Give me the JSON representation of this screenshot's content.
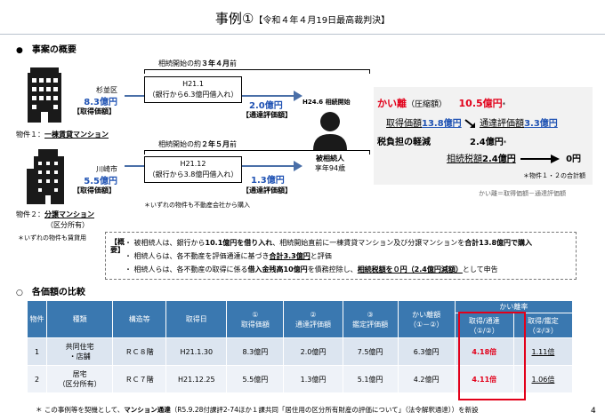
{
  "header": {
    "title": "事例①",
    "subtitle": "【令和４年４月19日最高裁判決】"
  },
  "section1": {
    "bullet": "●",
    "title": "事案の概要"
  },
  "prop1": {
    "location": "杉並区",
    "price": "8.3億円",
    "price_label": "【取得価額】",
    "caption_label": "物件１：",
    "caption_name": "一棟賃貸マンション",
    "period_prefix": "相続開始の約",
    "period_years": "３年４月",
    "period_suffix": "前",
    "box_line1": "H21.1",
    "box_line2": "（銀行から6.3億円借入れ）",
    "appraisal": "2.0億円",
    "appraisal_label": "【通達評価額】"
  },
  "prop2": {
    "location": "川崎市",
    "price": "5.5億円",
    "price_label": "【取得価額】",
    "caption_label": "物件２：",
    "caption_name": "分譲マンション",
    "caption_sub": "（区分所有）",
    "period_prefix": "相続開始の約",
    "period_years": "２年５月",
    "period_suffix": "前",
    "box_line1": "H21.12",
    "box_line2": "（銀行から3.8億円借入れ）",
    "appraisal": "1.3億円",
    "appraisal_label": "【通達評価額】"
  },
  "note_props": "＊いずれの物件も賃貸用",
  "note_nocompany": "＊いずれの物件も不動産会社から購入",
  "person": {
    "top_label": "H24.6 相続開始",
    "name": "被相続人",
    "age": "享年94歳"
  },
  "gap": {
    "label": "かい離",
    "label_paren": "（圧縮額）",
    "value": "10.5億円",
    "value_mark": "*",
    "acq_label": "取得価額",
    "acq_value": "13.8億円",
    "eval_label": "通達評価額",
    "eval_value": "3.3億円",
    "tax_label": "税負担の軽減",
    "tax_value": "2.4億円",
    "tax_mark": "*",
    "tax_row_label": "相続税額",
    "tax_row_value": "2.4億円",
    "tax_zero": "0円",
    "footnote": "＊物件１・２の合計額",
    "formula": "かい離＝取得価額－通達評価額"
  },
  "summary": {
    "side_label": "【概要】",
    "items": [
      {
        "pre": "被相続人は、銀行から",
        "bold1": "10.1億円を借り入れ",
        "mid": "、相続開始直前に一棟賃貸マンション及び分譲マンションを",
        "bold2": "合計13.8億円で購入",
        "post": ""
      },
      {
        "pre": "相続人らは、各不動産を評価通達に基づき",
        "bold1": "合計3.3億円",
        "mid": "と評価",
        "bold2": "",
        "post": ""
      },
      {
        "pre": "相続人らは、各不動産の取得に係る",
        "bold1": "借入金残高10億円",
        "mid": "を債務控除し、",
        "bold2": "相続税額を０円（2.4億円減額）",
        "post": "として申告"
      }
    ]
  },
  "section2": {
    "bullet": "○",
    "title": "各価額の比較"
  },
  "table": {
    "headers": {
      "no": "物件",
      "type": "種類",
      "structure": "構造等",
      "date": "取得日",
      "acq_num": "①",
      "acq": "取得価額",
      "eval_num": "②",
      "eval": "通達評価額",
      "app_num": "③",
      "app": "鑑定評価額",
      "gapamt": "かい離額",
      "gapamt_sub": "（①－②）",
      "ratio": "かい離率",
      "ratio_a": "取得/通達",
      "ratio_a_sub": "（①/②）",
      "ratio_b": "取得/鑑定",
      "ratio_b_sub": "（②/③）"
    },
    "rows": [
      {
        "no": "1",
        "type1": "共同住宅",
        "type2": "・店舗",
        "structure": "ＲＣ８階",
        "date": "H21.1.30",
        "acq": "8.3億円",
        "eval": "2.0億円",
        "app": "7.5億円",
        "gap": "6.3億円",
        "ratio_a": "4.18倍",
        "ratio_b": "1.11倍"
      },
      {
        "no": "2",
        "type1": "居宅",
        "type2": "（区分所有）",
        "structure": "ＲＣ７階",
        "date": "H21.12.25",
        "acq": "5.5億円",
        "eval": "1.3億円",
        "app": "5.1億円",
        "gap": "4.2億円",
        "ratio_a": "4.11倍",
        "ratio_b": "1.06倍"
      }
    ]
  },
  "footer": {
    "text": "＊ この事例等を契機として、",
    "bold": "マンション通達",
    "rest": "（R5.9.28付課評2-74ほか１課共同「居住用の区分所有財産の評価について」（法令解釈通達））を新設"
  },
  "page_number": "4",
  "colors": {
    "accent_blue": "#1f52b3",
    "accent_red": "#e2001a",
    "table_header": "#3a78b0",
    "table_row": "#dce5f0"
  }
}
